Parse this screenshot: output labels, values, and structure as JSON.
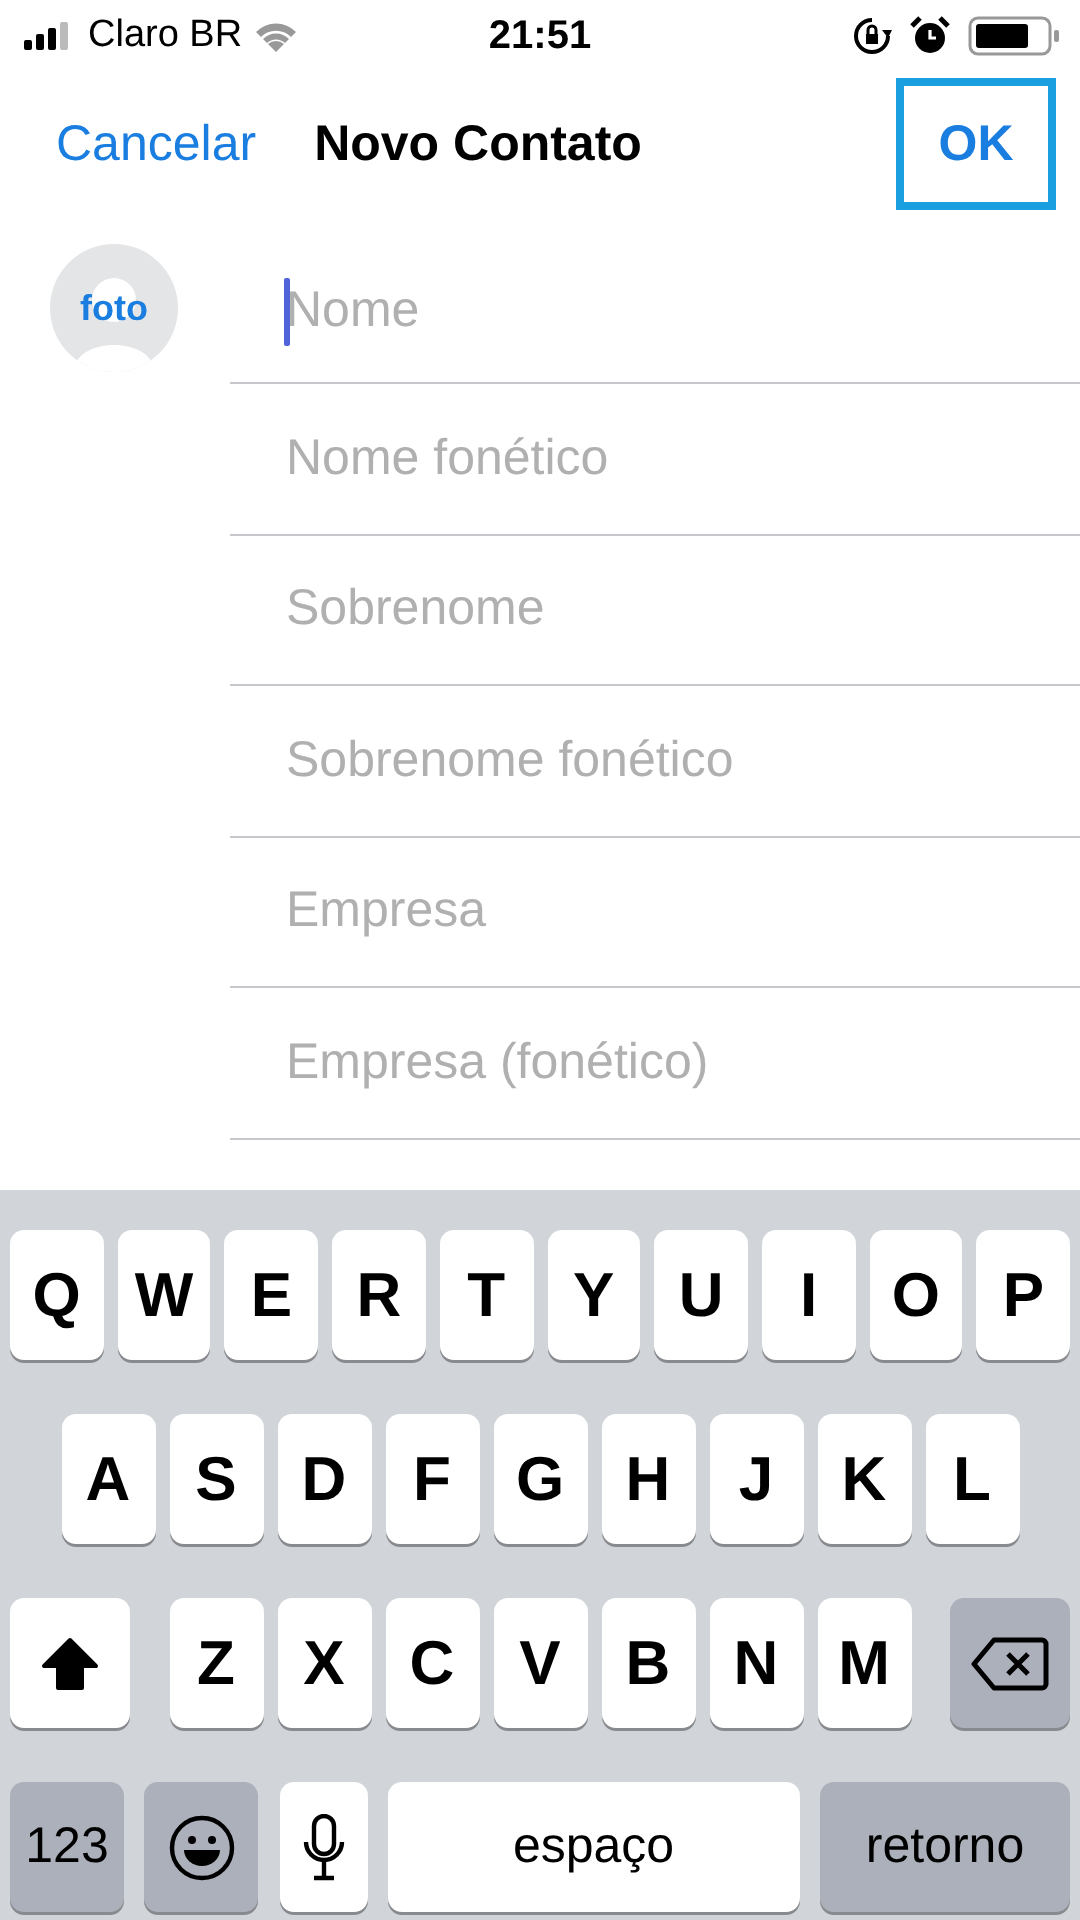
{
  "status_bar": {
    "carrier": "Claro BR",
    "time": "21:51"
  },
  "nav_bar": {
    "cancel": "Cancelar",
    "title": "Novo Contato",
    "done": {
      "label": "OK",
      "highlighted": true
    }
  },
  "photo": {
    "label": "foto"
  },
  "fields": [
    {
      "placeholder": "Nome",
      "focused": true
    },
    {
      "placeholder": "Nome fonético",
      "focused": false
    },
    {
      "placeholder": "Sobrenome",
      "focused": false
    },
    {
      "placeholder": "Sobrenome fonético",
      "focused": false
    },
    {
      "placeholder": "Empresa",
      "focused": false
    },
    {
      "placeholder": "Empresa (fonético)",
      "focused": false
    }
  ],
  "keyboard": {
    "rows": [
      [
        {
          "kind": "letter",
          "label": "Q"
        },
        {
          "kind": "letter",
          "label": "W"
        },
        {
          "kind": "letter",
          "label": "E"
        },
        {
          "kind": "letter",
          "label": "R"
        },
        {
          "kind": "letter",
          "label": "T"
        },
        {
          "kind": "letter",
          "label": "Y"
        },
        {
          "kind": "letter",
          "label": "U"
        },
        {
          "kind": "letter",
          "label": "I"
        },
        {
          "kind": "letter",
          "label": "O"
        },
        {
          "kind": "letter",
          "label": "P"
        }
      ],
      [
        {
          "kind": "letter",
          "label": "A"
        },
        {
          "kind": "letter",
          "label": "S"
        },
        {
          "kind": "letter",
          "label": "D"
        },
        {
          "kind": "letter",
          "label": "F"
        },
        {
          "kind": "letter",
          "label": "G"
        },
        {
          "kind": "letter",
          "label": "H"
        },
        {
          "kind": "letter",
          "label": "J"
        },
        {
          "kind": "letter",
          "label": "K"
        },
        {
          "kind": "letter",
          "label": "L"
        }
      ],
      [
        {
          "kind": "shift",
          "on": true
        },
        {
          "kind": "letter",
          "label": "Z"
        },
        {
          "kind": "letter",
          "label": "X"
        },
        {
          "kind": "letter",
          "label": "C"
        },
        {
          "kind": "letter",
          "label": "V"
        },
        {
          "kind": "letter",
          "label": "B"
        },
        {
          "kind": "letter",
          "label": "N"
        },
        {
          "kind": "letter",
          "label": "M"
        },
        {
          "kind": "delete"
        }
      ]
    ],
    "bottom_row": [
      {
        "kind": "numbers",
        "label": "123"
      },
      {
        "kind": "emoji"
      },
      {
        "kind": "mic"
      },
      {
        "kind": "space",
        "label": "espaço"
      },
      {
        "kind": "return",
        "label": "retorno"
      }
    ]
  }
}
